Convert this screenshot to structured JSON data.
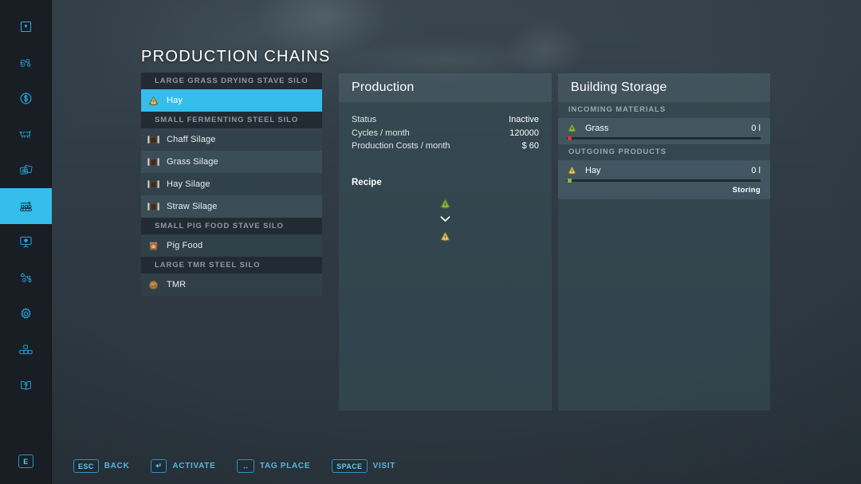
{
  "page": {
    "title": "PRODUCTION CHAINS"
  },
  "sidebar": {
    "items": [
      {
        "name": "sidebar-item-map",
        "icon": "map-pin-icon",
        "active": false
      },
      {
        "name": "sidebar-item-vehicles",
        "icon": "tractor-icon",
        "active": false
      },
      {
        "name": "sidebar-item-finances",
        "icon": "dollar-coin-icon",
        "active": false
      },
      {
        "name": "sidebar-item-animals",
        "icon": "cow-icon",
        "active": false
      },
      {
        "name": "sidebar-item-contracts",
        "icon": "documents-icon",
        "active": false
      },
      {
        "name": "sidebar-item-production",
        "icon": "conveyor-icon",
        "active": true
      },
      {
        "name": "sidebar-item-statistics",
        "icon": "presentation-icon",
        "active": false
      },
      {
        "name": "sidebar-item-vehicle-config",
        "icon": "tractor-gear-icon",
        "active": false
      },
      {
        "name": "sidebar-item-settings",
        "icon": "gear-icon",
        "active": false
      },
      {
        "name": "sidebar-item-construction",
        "icon": "blocks-icon",
        "active": false
      },
      {
        "name": "sidebar-item-help",
        "icon": "book-help-icon",
        "active": false
      }
    ],
    "bottom_key": "E"
  },
  "chain_list": [
    {
      "type": "group",
      "label": "LARGE GRASS DRYING STAVE SILO"
    },
    {
      "type": "item",
      "label": "Hay",
      "icon": "hay-icon",
      "selected": true
    },
    {
      "type": "group",
      "label": "SMALL FERMENTING STEEL SILO"
    },
    {
      "type": "item",
      "label": "Chaff Silage",
      "icon": "silage-icon",
      "selected": false
    },
    {
      "type": "item",
      "label": "Grass Silage",
      "icon": "silage-icon",
      "selected": false
    },
    {
      "type": "item",
      "label": "Hay Silage",
      "icon": "silage-icon",
      "selected": false
    },
    {
      "type": "item",
      "label": "Straw Silage",
      "icon": "silage-icon",
      "selected": false
    },
    {
      "type": "group",
      "label": "SMALL PIG FOOD STAVE SILO"
    },
    {
      "type": "item",
      "label": "Pig Food",
      "icon": "pigfood-icon",
      "selected": false
    },
    {
      "type": "group",
      "label": "LARGE TMR STEEL SILO"
    },
    {
      "type": "item",
      "label": "TMR",
      "icon": "tmr-icon",
      "selected": false
    }
  ],
  "production": {
    "title": "Production",
    "rows": [
      {
        "label": "Status",
        "value": "Inactive"
      },
      {
        "label": "Cycles / month",
        "value": "120000"
      },
      {
        "label": "Production Costs / month",
        "value": "$ 60"
      }
    ],
    "recipe_label": "Recipe",
    "recipe": {
      "input_icon": "grass-icon",
      "arrow_icon": "chevron-down-icon",
      "output_icon": "hay-icon"
    }
  },
  "storage": {
    "title": "Building Storage",
    "incoming_header": "INCOMING MATERIALS",
    "incoming": [
      {
        "name": "Grass",
        "icon": "grass-icon",
        "amount": "0 l",
        "fill_percent": 0,
        "marker_color": "#cf3b3b"
      }
    ],
    "outgoing_header": "OUTGOING PRODUCTS",
    "outgoing": [
      {
        "name": "Hay",
        "icon": "hay-icon",
        "amount": "0 l",
        "fill_percent": 0,
        "marker_color": "#7dbd3f",
        "status": "Storing"
      }
    ]
  },
  "helpbar": [
    {
      "key": "ESC",
      "label": "BACK"
    },
    {
      "key": "↵",
      "label": "ACTIVATE"
    },
    {
      "key": "↔",
      "label": "TAG PLACE"
    },
    {
      "key": "SPACE",
      "label": "VISIT"
    }
  ],
  "colors": {
    "accent": "#35bdeb",
    "accent_text": "#56b7e0",
    "panel_bg": "#374d57",
    "panel_head": "#566e78"
  }
}
